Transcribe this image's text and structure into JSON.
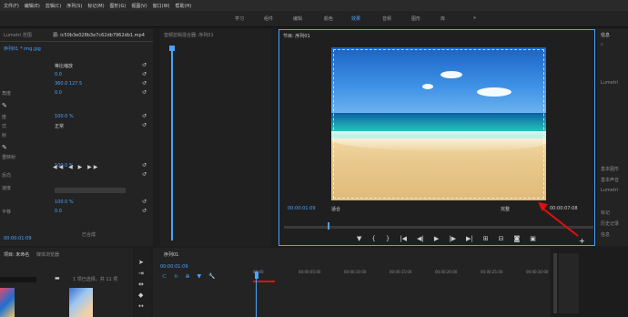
{
  "menu": [
    "文件(F)",
    "编辑(E)",
    "剪辑(C)",
    "序列(S)",
    "标记(M)",
    "图形(G)",
    "视图(V)",
    "窗口(W)",
    "帮助(H)"
  ],
  "workspaces": [
    "学习",
    "组件",
    "编辑",
    "颜色",
    "效果",
    "音频",
    "图形",
    "库"
  ],
  "active_workspace": "效果",
  "effect_controls": {
    "tabs": [
      "Lumetri 范围",
      "源: ic50b3e028b3e7c62db7962db1.mp4",
      "音频剪辑混合器: 序列01"
    ],
    "clip": "序列01 * img.jpg",
    "rows": [
      {
        "label": "",
        "value": "等比缩放",
        "vcolor": "#cfcfcf"
      },
      {
        "label": "",
        "value": "0.0",
        "vcolor": "#4aa3ff"
      },
      {
        "label": "",
        "value": "360.0    127.5",
        "vcolor": "#4aa3ff"
      },
      {
        "label": "角度",
        "value": "0.0",
        "vcolor": "#4aa3ff"
      },
      {
        "label": "度",
        "value": "100.0 %",
        "vcolor": "#4aa3ff"
      },
      {
        "label": "式",
        "value": "正常",
        "vcolor": "#cfcfcf"
      },
      {
        "label": "射",
        "value": "",
        "vcolor": "#4aa3ff"
      },
      {
        "label": "",
        "value": "",
        "vcolor": "#4aa3ff"
      },
      {
        "label": "重映射",
        "value": "",
        "vcolor": "#4aa3ff"
      },
      {
        "label": "",
        "value": "100.0 %",
        "vcolor": "#4aa3ff"
      },
      {
        "label": "反向",
        "value": "",
        "vcolor": "#4aa3ff"
      },
      {
        "label": "速度",
        "value": "",
        "vcolor": "#4aa3ff"
      },
      {
        "label": "",
        "value": "100.0 %",
        "vcolor": "#4aa3ff"
      },
      {
        "label": "平移",
        "value": "0.0",
        "vcolor": "#4aa3ff"
      }
    ],
    "footer_time": "00:00:01:09",
    "checkbox_label": "已合成"
  },
  "program_monitor": {
    "title": "节目: 序列01",
    "current_time": "00:00:01:09",
    "fit": "适合",
    "quality": "完整",
    "duration": "00:00:07:08"
  },
  "right_panel": {
    "header": "信息",
    "items": [
      "效果",
      "Lumetri",
      "基本图形",
      "基本声音",
      "Lumetri",
      "标记",
      "历史记录",
      "信息"
    ]
  },
  "project": {
    "tabs": [
      "项目: 未命名",
      "媒体浏览器"
    ],
    "status": "1 项已选择，共 11 项"
  },
  "timeline": {
    "title": "序列01",
    "current_time": "00:00:01:09",
    "ticks": [
      "00:00",
      "00:00:05:00",
      "00:00:10:00",
      "00:00:15:00",
      "00:00:20:00",
      "00:00:25:00",
      "00:00:30:00"
    ]
  },
  "colors": {
    "accent": "#4aa3ff",
    "arrow": "#e01010"
  }
}
